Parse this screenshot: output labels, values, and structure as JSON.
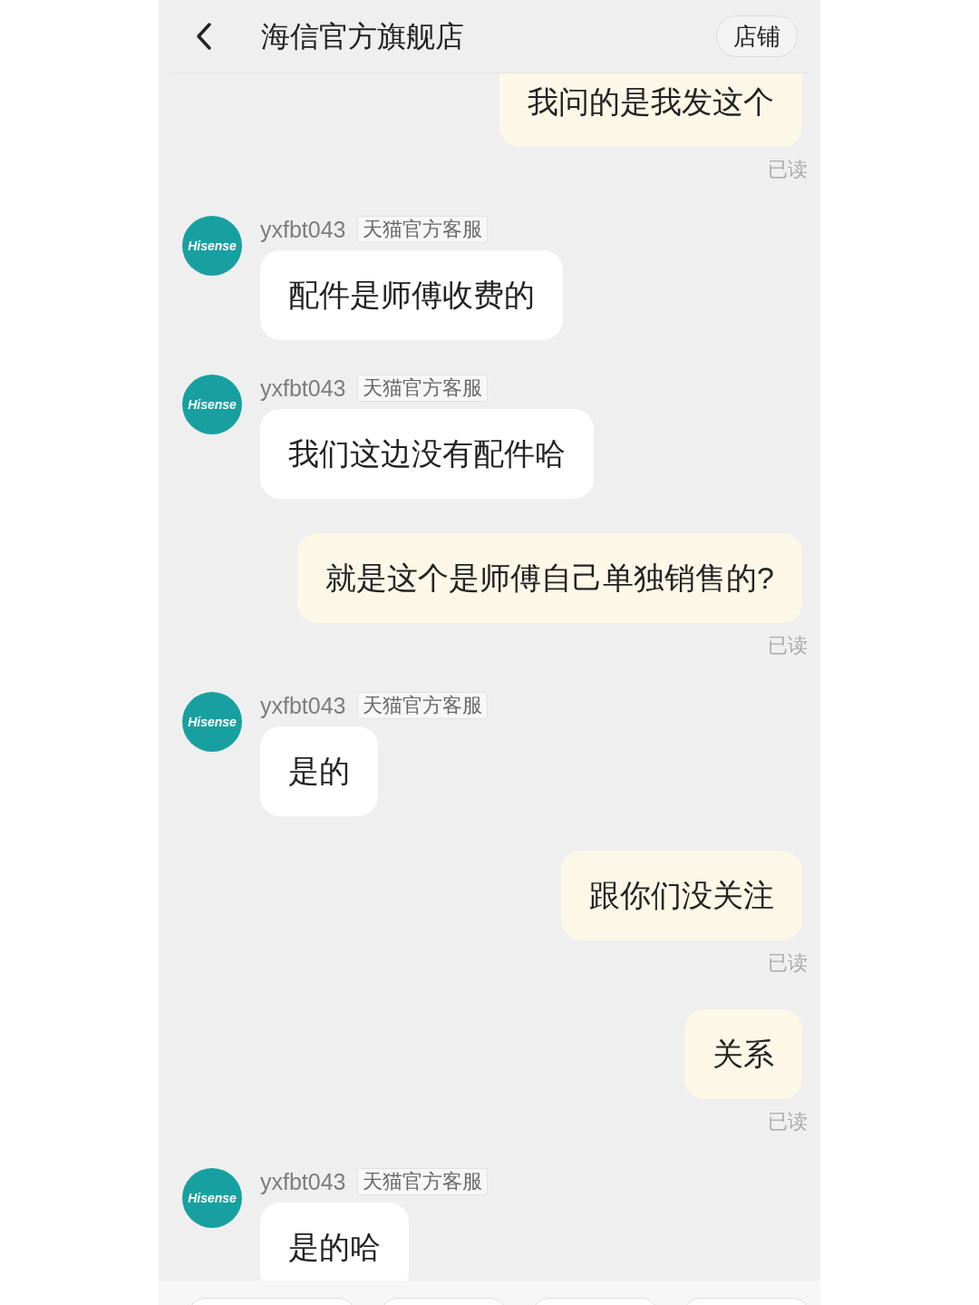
{
  "header": {
    "title": "海信官方旗舰店",
    "store_button": "店铺"
  },
  "messages": [
    {
      "kind": "outgoing",
      "text": "我问的是我发这个",
      "status": "已读"
    },
    {
      "kind": "incoming",
      "avatar_text": "Hisense",
      "sender": "yxfbt043",
      "tag": "天猫官方客服",
      "text": "配件是师傅收费的"
    },
    {
      "kind": "incoming",
      "avatar_text": "Hisense",
      "sender": "yxfbt043",
      "tag": "天猫官方客服",
      "text": "我们这边没有配件哈"
    },
    {
      "kind": "outgoing",
      "text": "就是这个是师傅自己单独销售的?",
      "status": "已读"
    },
    {
      "kind": "incoming",
      "avatar_text": "Hisense",
      "sender": "yxfbt043",
      "tag": "天猫官方客服",
      "text": "是的"
    },
    {
      "kind": "outgoing",
      "text": "跟你们没关注",
      "status": "已读"
    },
    {
      "kind": "outgoing",
      "text": "关系",
      "status": "已读"
    },
    {
      "kind": "incoming",
      "avatar_text": "Hisense",
      "sender": "yxfbt043",
      "tag": "天猫官方客服",
      "text": "是的哈"
    }
  ]
}
